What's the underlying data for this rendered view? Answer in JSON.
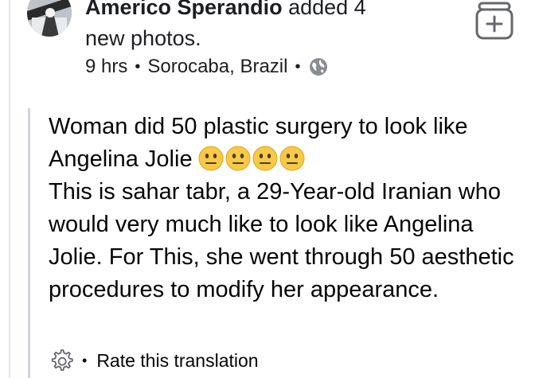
{
  "post": {
    "author": "Americo Sperandio",
    "action_text": " added 4",
    "action_text_2": "new photos.",
    "time": "9 hrs",
    "location": "Sorocaba, Brazil",
    "separator": "•",
    "privacy_icon": "globe-icon"
  },
  "body": {
    "line1": "Woman did 50 plastic surgery to look like Angelina Jolie",
    "emoji_icon": "neutral-face-emoji",
    "emoji_count": 4,
    "paragraph": "This is sahar tabr, a 29-Year-old Iranian who would very much like to look like Angelina Jolie. For This, she went through 50 aesthetic procedures to modify her appearance."
  },
  "translation": {
    "icon": "gear-icon",
    "separator": "•",
    "rate_label": "Rate this translation"
  },
  "colors": {
    "text": "#050505",
    "muted_line": "#d0d3d8",
    "emoji_fill": "#f7c948",
    "icon_gray": "#65676b"
  }
}
